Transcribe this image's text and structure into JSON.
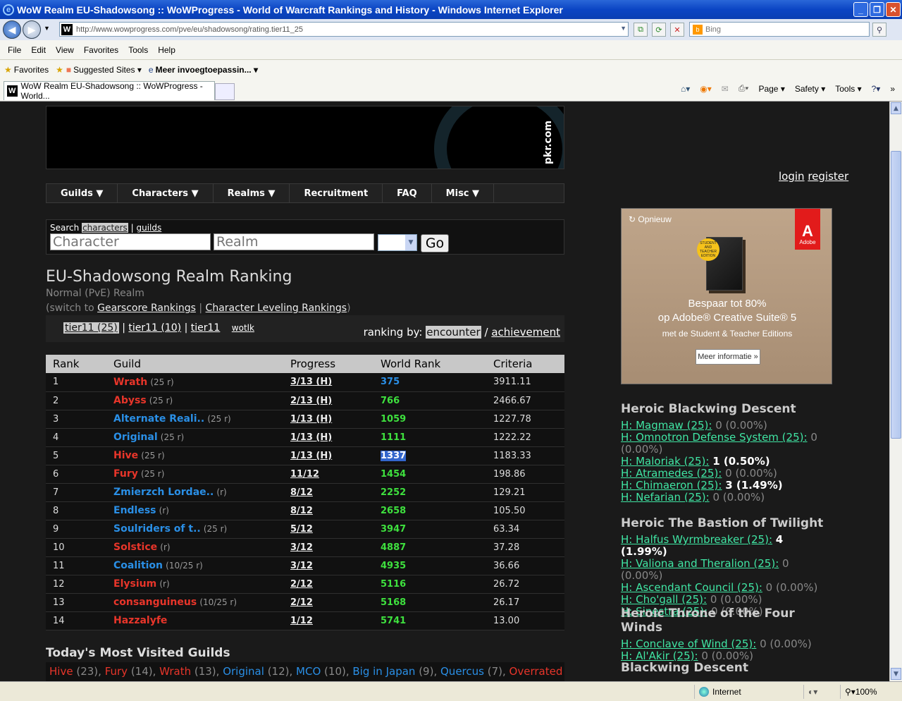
{
  "window": {
    "title": "WoW Realm EU-Shadowsong :: WoWProgress - World of Warcraft Rankings and History - Windows Internet Explorer",
    "minimize": "_",
    "maximize": "❐",
    "close": "✕"
  },
  "address": {
    "url": "http://www.wowprogress.com/pve/eu/shadowsong/rating.tier11_25",
    "search_placeholder": "Bing"
  },
  "menu": [
    "File",
    "Edit",
    "View",
    "Favorites",
    "Tools",
    "Help"
  ],
  "favorites_bar": {
    "favorites": "Favorites",
    "suggested": "Suggested Sites ▾",
    "more": "Meer invoegtoepassin... ▾"
  },
  "tab": {
    "title": "WoW Realm EU-Shadowsong :: WoWProgress - World...",
    "tools": [
      "Page ▾",
      "Safety ▾",
      "Tools ▾"
    ]
  },
  "banner": {
    "text": "pkr.com"
  },
  "nav": [
    "Guilds ▼",
    "Characters ▼",
    "Realms ▼",
    "Recruitment",
    "FAQ",
    "Misc ▼"
  ],
  "search": {
    "label": "Search",
    "characters": "characters",
    "sep": "|",
    "guilds": "guilds",
    "character_placeholder": "Character",
    "realm_placeholder": "Realm",
    "go": "Go"
  },
  "realm": {
    "title": "EU-Shadowsong Realm Ranking",
    "subtitle": "Normal (PvE) Realm",
    "switch_prefix": "(switch to ",
    "gearscore": "Gearscore Rankings",
    "separator": " | ",
    "leveling": "Character Leveling Rankings",
    "switch_suffix": ")"
  },
  "tiers": {
    "current": "tier11 (25)",
    "t10": "tier11 (10)",
    "t11": "tier11",
    "wotlk": "wotlk",
    "ranking_by": "ranking by:",
    "encounter": "encounter",
    "slash": "/",
    "achievement": "achievement"
  },
  "table": {
    "headers": [
      "Rank",
      "Guild",
      "Progress",
      "World Rank",
      "Criteria"
    ],
    "rows": [
      {
        "rank": "1",
        "guild": "Wrath",
        "faction": "h",
        "size": "(25 r)",
        "progress": "3/13 (H)",
        "world": "375",
        "wr_style": "blue",
        "criteria": "3911.11"
      },
      {
        "rank": "2",
        "guild": "Abyss",
        "faction": "h",
        "size": "(25 r)",
        "progress": "2/13 (H)",
        "world": "766",
        "wr_style": "",
        "criteria": "2466.67"
      },
      {
        "rank": "3",
        "guild": "Alternate Reali..",
        "faction": "a",
        "size": "(25 r)",
        "progress": "1/13 (H)",
        "world": "1059",
        "wr_style": "",
        "criteria": "1227.78"
      },
      {
        "rank": "4",
        "guild": "Original",
        "faction": "a",
        "size": "(25 r)",
        "progress": "1/13 (H)",
        "world": "1111",
        "wr_style": "",
        "criteria": "1222.22"
      },
      {
        "rank": "5",
        "guild": "Hive",
        "faction": "h",
        "size": "(25 r)",
        "progress": "1/13 (H)",
        "world": "1337",
        "wr_style": "hl",
        "criteria": "1183.33"
      },
      {
        "rank": "6",
        "guild": "Fury",
        "faction": "h",
        "size": "(25 r)",
        "progress": "11/12",
        "world": "1454",
        "wr_style": "",
        "criteria": "198.86"
      },
      {
        "rank": "7",
        "guild": "Zmierzch Lordae..",
        "faction": "a",
        "size": "(r)",
        "progress": "8/12",
        "world": "2252",
        "wr_style": "",
        "criteria": "129.21"
      },
      {
        "rank": "8",
        "guild": "Endless",
        "faction": "a",
        "size": "(r)",
        "progress": "8/12",
        "world": "2658",
        "wr_style": "",
        "criteria": "105.50"
      },
      {
        "rank": "9",
        "guild": "Soulriders of t..",
        "faction": "a",
        "size": "(25 r)",
        "progress": "5/12",
        "world": "3947",
        "wr_style": "",
        "criteria": "63.34"
      },
      {
        "rank": "10",
        "guild": "Solstice",
        "faction": "h",
        "size": "(r)",
        "progress": "3/12",
        "world": "4887",
        "wr_style": "",
        "criteria": "37.28"
      },
      {
        "rank": "11",
        "guild": "Coalition",
        "faction": "a",
        "size": "(10/25 r)",
        "progress": "3/12",
        "world": "4935",
        "wr_style": "",
        "criteria": "36.66"
      },
      {
        "rank": "12",
        "guild": "Elysium",
        "faction": "h",
        "size": "(r)",
        "progress": "2/12",
        "world": "5116",
        "wr_style": "",
        "criteria": "26.72"
      },
      {
        "rank": "13",
        "guild": "consanguineus",
        "faction": "h",
        "size": "(10/25 r)",
        "progress": "2/12",
        "world": "5168",
        "wr_style": "",
        "criteria": "26.17"
      },
      {
        "rank": "14",
        "guild": "Hazzalyfe",
        "faction": "h",
        "size": "",
        "progress": "1/12",
        "world": "5741",
        "wr_style": "",
        "criteria": "13.00"
      }
    ]
  },
  "visited": {
    "title": "Today's Most Visited Guilds",
    "items": [
      {
        "name": "Hive",
        "count": "(23),",
        "faction": "h"
      },
      {
        "name": "Fury",
        "count": "(14),",
        "faction": "h"
      },
      {
        "name": "Wrath",
        "count": "(13),",
        "faction": "h"
      },
      {
        "name": "Original",
        "count": "(12),",
        "faction": "a"
      },
      {
        "name": "MCO",
        "count": "(10),",
        "faction": "a"
      },
      {
        "name": "Big in Japan",
        "count": "(9),",
        "faction": "a"
      },
      {
        "name": "Quercus",
        "count": "(7),",
        "faction": "a"
      },
      {
        "name": "Overrated",
        "count": "",
        "faction": "h"
      }
    ]
  },
  "login": {
    "login": "login",
    "register": "register"
  },
  "ad": {
    "reload": "Opnieuw",
    "brand": "Adobe",
    "box_badge": "STUDENT AND TEACHER EDITION",
    "line1": "Bespaar tot 80%",
    "line2": "op Adobe® Creative Suite® 5",
    "line3": "met de Student & Teacher Editions",
    "more": "Meer informatie »"
  },
  "encounters": [
    {
      "head": "Heroic Blackwing Descent",
      "items": [
        {
          "name": "H: Magmaw (25):",
          "val": "0 (0.00%)",
          "bold": false
        },
        {
          "name": "H: Omnotron Defense System (25):",
          "val": "0 (0.00%)",
          "bold": false
        },
        {
          "name": "H: Maloriak (25):",
          "val": "1 (0.50%)",
          "bold": true
        },
        {
          "name": "H: Atramedes (25):",
          "val": "0 (0.00%)",
          "bold": false
        },
        {
          "name": "H: Chimaeron (25):",
          "val": "3 (1.49%)",
          "bold": true
        },
        {
          "name": "H: Nefarian (25):",
          "val": "0 (0.00%)",
          "bold": false
        }
      ]
    },
    {
      "head": "Heroic The Bastion of Twilight",
      "items": [
        {
          "name": "H: Halfus Wyrmbreaker (25):",
          "val": "4 (1.99%)",
          "bold": true
        },
        {
          "name": "H: Valiona and Theralion (25):",
          "val": "0 (0.00%)",
          "bold": false
        },
        {
          "name": "H: Ascendant Council (25):",
          "val": "0 (0.00%)",
          "bold": false
        },
        {
          "name": "H: Cho'gall (25):",
          "val": "0 (0.00%)",
          "bold": false
        },
        {
          "name": "H: Sinestra (25):",
          "val": "0 (0.00%)",
          "bold": false
        }
      ]
    },
    {
      "head": "Heroic Throne of the Four Winds",
      "items": [
        {
          "name": "H: Conclave of Wind (25):",
          "val": "0 (0.00%)",
          "bold": false
        },
        {
          "name": "H: Al'Akir (25):",
          "val": "0 (0.00%)",
          "bold": false
        }
      ]
    },
    {
      "head": "Blackwing Descent",
      "items": []
    }
  ],
  "status": {
    "zone": "Internet",
    "zoom": "100%"
  }
}
